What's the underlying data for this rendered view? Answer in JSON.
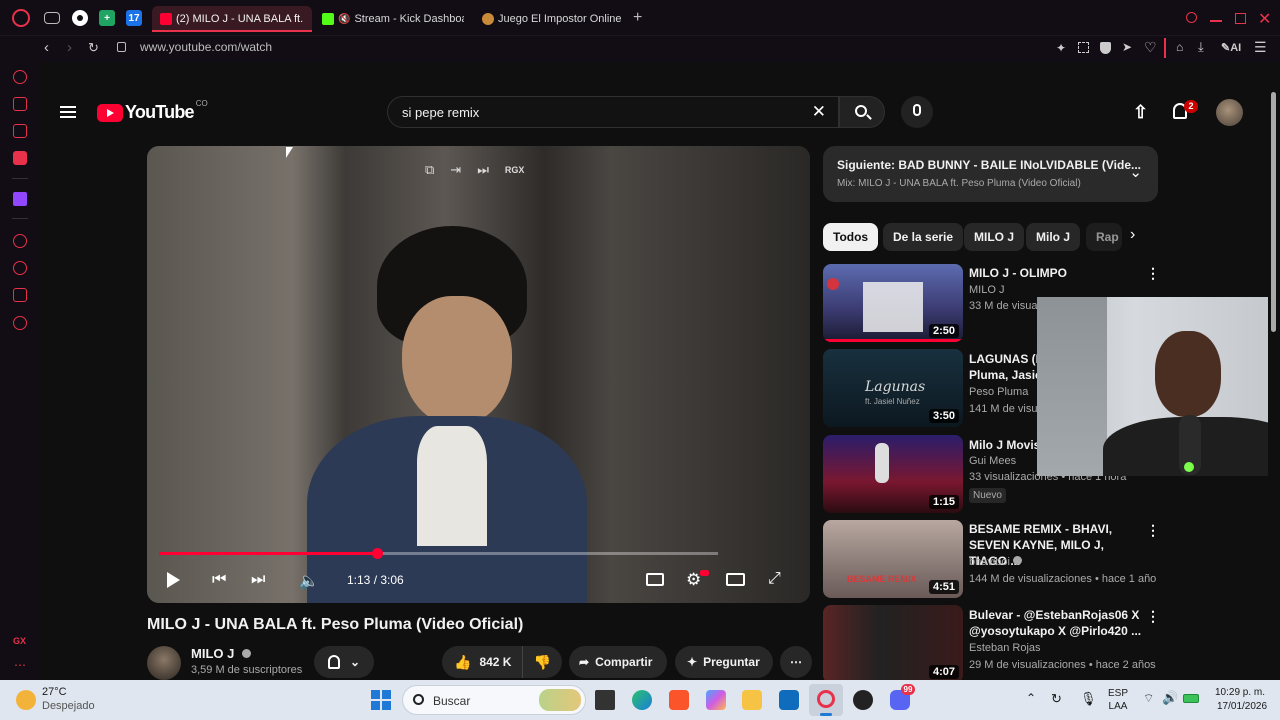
{
  "browser": {
    "tabs": [
      {
        "label": "(2) MILO J - UNA BALA ft.",
        "active": true
      },
      {
        "label": "Stream - Kick Dashboa",
        "active": false
      },
      {
        "label": "Juego El Impostor Online -",
        "active": false
      }
    ],
    "pinned_badge": "17",
    "url": "www.youtube.com/watch",
    "ai_label": "AI"
  },
  "youtube": {
    "logo_text": "YouTube",
    "country": "CO",
    "search_value": "si pepe remix",
    "notifications_count": "2",
    "player": {
      "time": "1:13 / 3:06",
      "progress": 0.39,
      "overlay_label": "RGX"
    },
    "video": {
      "title": "MILO J - UNA BALA ft. Peso Pluma (Video Oficial)",
      "channel": "MILO J",
      "subscribers": "3,59 M de suscriptores",
      "likes": "842 K",
      "share_label": "Compartir",
      "ask_label": "Preguntar"
    },
    "up_next": {
      "title": "Siguiente: BAD BUNNY - BAILE INoLVIDABLE (Vide...",
      "subtitle": "Mix: MILO J - UNA BALA ft. Peso Pluma (Video Oficial)"
    },
    "chips": [
      "Todos",
      "De la serie",
      "MILO J",
      "Milo J",
      "Rap"
    ],
    "related": [
      {
        "title": "MILO J - OLIMPO",
        "channel": "MILO J",
        "meta": "33 M de visuali",
        "duration": "2:50"
      },
      {
        "title": "LAGUNAS (L",
        "title2": "Pluma, Jasie",
        "channel": "Peso Pluma",
        "meta": "141 M de visua",
        "duration": "3:50",
        "thumb_text": "Lagunas",
        "thumb_sub": "ft. Jasiel Nuñez"
      },
      {
        "title": "Milo J  Movis",
        "channel": "Gui Mees",
        "meta": "33 visualizaciones • hace 1 hora",
        "badge": "Nuevo",
        "duration": "1:15"
      },
      {
        "title": "BESAME REMIX - BHAVI,",
        "title2": "SEVEN KAYNE, MILO J, TIAGO ...",
        "channel": "bhaviboi",
        "meta": "144 M de visualizaciones • hace 1 año",
        "duration": "4:51",
        "thumb_text": "BESAME REMIX"
      },
      {
        "title": "Bulevar - @EstebanRojas06  X",
        "title2": "@yosoytukapo X @Pirlo420  ...",
        "channel": "Esteban Rojas",
        "meta": "29 M de visualizaciones • hace 2 años",
        "duration": "4:07"
      }
    ]
  },
  "taskbar": {
    "weather_temp": "27°C",
    "weather_desc": "Despejado",
    "search_placeholder": "Buscar",
    "lang": "ESP",
    "lang2": "LAA",
    "time": "10:29 p. m.",
    "date": "17/01/2026",
    "discord_badge": "99"
  },
  "colors": {
    "accent": "#ff0033",
    "opera_red": "#e8314a",
    "background": "#0f0f0f"
  }
}
